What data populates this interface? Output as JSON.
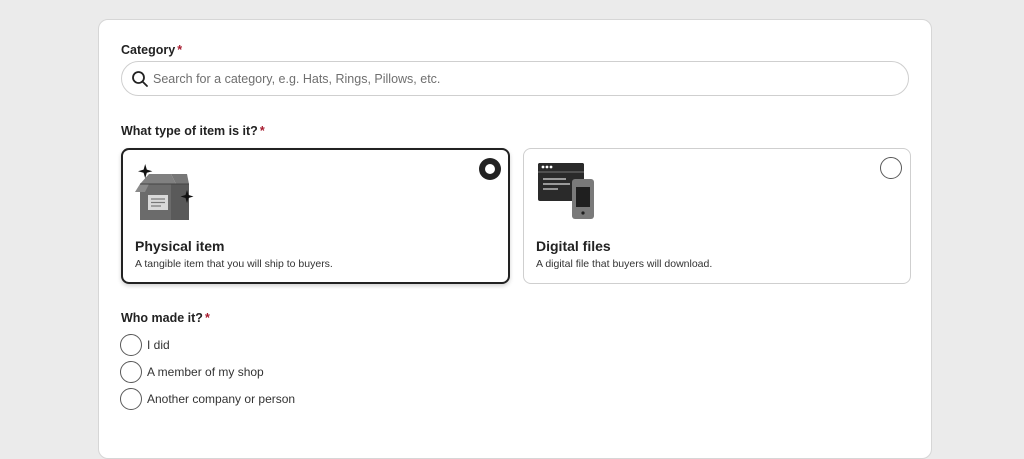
{
  "category": {
    "label": "Category",
    "required_mark": "*",
    "search_placeholder": "Search for a category, e.g. Hats, Rings, Pillows, etc.",
    "search_value": ""
  },
  "item_type": {
    "label": "What type of item is it?",
    "required_mark": "*",
    "options": [
      {
        "title": "Physical item",
        "description": "A tangible item that you will ship to buyers.",
        "selected": true,
        "icon": "box-icon"
      },
      {
        "title": "Digital files",
        "description": "A digital file that buyers will download.",
        "selected": false,
        "icon": "devices-icon"
      }
    ]
  },
  "who_made": {
    "label": "Who made it?",
    "required_mark": "*",
    "options": [
      {
        "label": "I did",
        "selected": false
      },
      {
        "label": "A member of my shop",
        "selected": false
      },
      {
        "label": "Another company or person",
        "selected": false
      }
    ]
  },
  "colors": {
    "required": "#a61a2e",
    "text": "#222222",
    "page_bg": "#ebebeb",
    "card_bg": "#ffffff"
  }
}
